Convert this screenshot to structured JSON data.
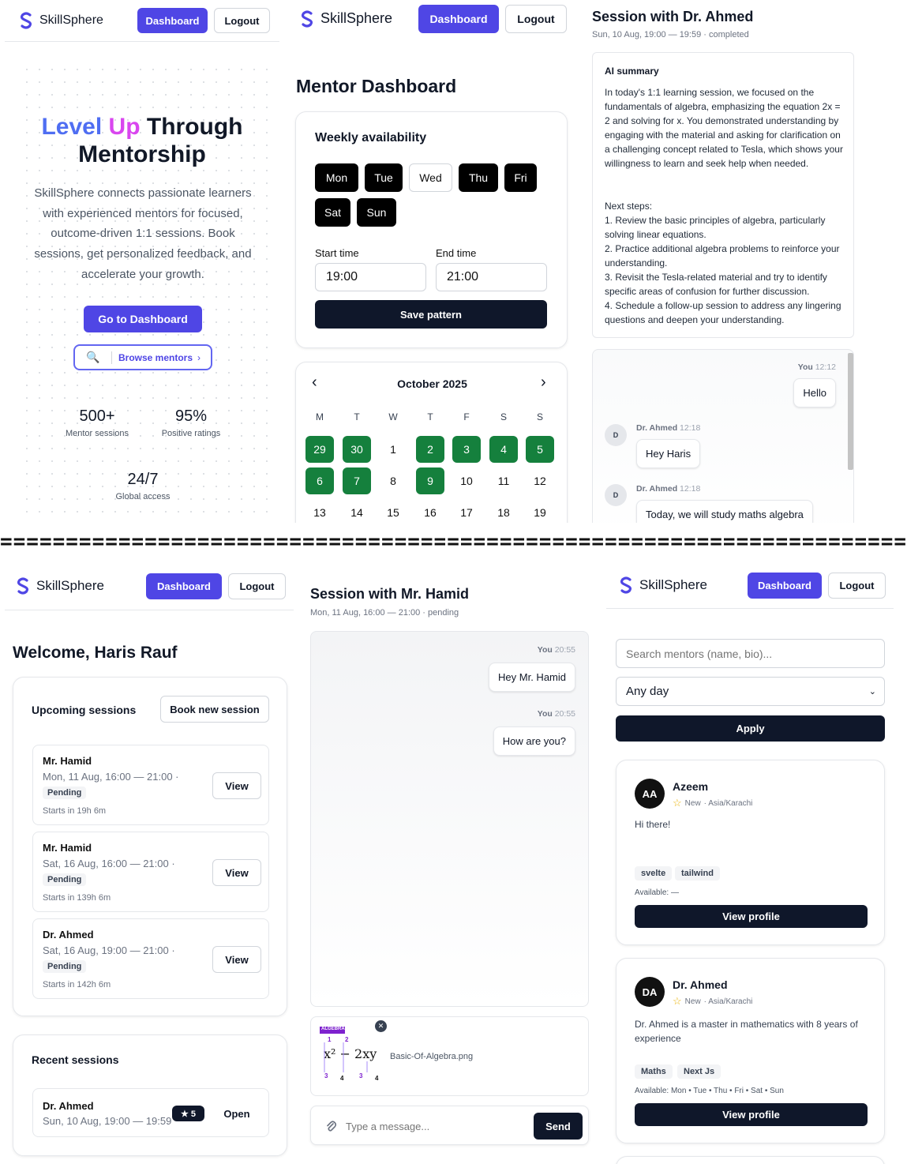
{
  "brand": {
    "name": "SkillSphere",
    "accent": "#4f46e5",
    "dark": "#0f172a",
    "green": "#15803d"
  },
  "nav": {
    "dashboard": "Dashboard",
    "logout": "Logout"
  },
  "divider": "========================================================================================================",
  "landing": {
    "title_w1": "Level",
    "title_w2": "Up",
    "title_rest": "Through",
    "title_line2": "Mentorship",
    "text": "SkillSphere connects passionate learners with experienced mentors for focused, outcome-driven 1:1 sessions. Book sessions, get personalized feedback, and accelerate your growth.",
    "cta": "Go to Dashboard",
    "browse": "Browse mentors",
    "browse_icon": "search-icon",
    "stats": [
      {
        "num": "500+",
        "label": "Mentor sessions"
      },
      {
        "num": "95%",
        "label": "Positive ratings"
      },
      {
        "num": "24/7",
        "label": "Global access"
      }
    ]
  },
  "mentor_dashboard": {
    "title": "Mentor Dashboard",
    "availability_title": "Weekly availability",
    "days": [
      {
        "label": "Mon",
        "on": true
      },
      {
        "label": "Tue",
        "on": true
      },
      {
        "label": "Wed",
        "on": false
      },
      {
        "label": "Thu",
        "on": true
      },
      {
        "label": "Fri",
        "on": true
      },
      {
        "label": "Sat",
        "on": true
      },
      {
        "label": "Sun",
        "on": true
      }
    ],
    "start_label": "Start time",
    "end_label": "End time",
    "start_value": "19:00",
    "end_value": "21:00",
    "save": "Save pattern",
    "calendar": {
      "month": "October 2025",
      "weekdays": [
        "M",
        "T",
        "W",
        "T",
        "F",
        "S",
        "S"
      ],
      "rows": [
        [
          {
            "d": "29",
            "a": true
          },
          {
            "d": "30",
            "a": true
          },
          {
            "d": "1",
            "a": false
          },
          {
            "d": "2",
            "a": true
          },
          {
            "d": "3",
            "a": true
          },
          {
            "d": "4",
            "a": true
          },
          {
            "d": "5",
            "a": true
          }
        ],
        [
          {
            "d": "6",
            "a": true
          },
          {
            "d": "7",
            "a": true
          },
          {
            "d": "8",
            "a": false
          },
          {
            "d": "9",
            "a": true
          },
          {
            "d": "10",
            "a": false
          },
          {
            "d": "11",
            "a": false
          },
          {
            "d": "12",
            "a": false
          }
        ],
        [
          {
            "d": "13",
            "a": false
          },
          {
            "d": "14",
            "a": false
          },
          {
            "d": "15",
            "a": false
          },
          {
            "d": "16",
            "a": false
          },
          {
            "d": "17",
            "a": false
          },
          {
            "d": "18",
            "a": false
          },
          {
            "d": "19",
            "a": false
          }
        ]
      ]
    }
  },
  "session_ahmed": {
    "title": "Session with Dr. Ahmed",
    "subtitle": "Sun, 10 Aug, 19:00 — 19:59 · completed",
    "ai_title": "AI summary",
    "ai_para": "In today's 1:1 learning session, we focused on the fundamentals of algebra, emphasizing the equation 2x = 2 and solving for x. You demonstrated understanding by engaging with the material and asking for clarification on a challenging concept related to Tesla, which shows your willingness to learn and seek help when needed.",
    "next_title": "Next steps:",
    "steps": [
      "1. Review the basic principles of algebra, particularly solving linear equations.",
      "2. Practice additional algebra problems to reinforce your understanding.",
      "3. Revisit the Tesla-related material and try to identify specific areas of confusion for further discussion.",
      "4. Schedule a follow-up session to address any lingering questions and deepen your understanding."
    ],
    "messages": [
      {
        "who": "You",
        "time": "12:12",
        "text": "Hello"
      },
      {
        "who": "Dr. Ahmed",
        "time": "12:18",
        "text": "Hey Haris",
        "avatar": "D"
      },
      {
        "who": "Dr. Ahmed",
        "time": "12:18",
        "text": "Today, we will study maths algebra",
        "avatar": "D"
      }
    ]
  },
  "student_dashboard": {
    "welcome": "Welcome, Haris Rauf",
    "upcoming_title": "Upcoming sessions",
    "book": "Book new session",
    "sessions": [
      {
        "name": "Mr. Hamid",
        "time": "Mon, 11 Aug, 16:00 — 21:00 ·",
        "status": "Pending",
        "starts": "Starts in 19h 6m",
        "action": "View"
      },
      {
        "name": "Mr. Hamid",
        "time": "Sat, 16 Aug, 16:00 — 21:00 ·",
        "status": "Pending",
        "starts": "Starts in 139h 6m",
        "action": "View"
      },
      {
        "name": "Dr. Ahmed",
        "time": "Sat, 16 Aug, 19:00 — 21:00 ·",
        "status": "Pending",
        "starts": "Starts in 142h 6m",
        "action": "View"
      }
    ],
    "recent_title": "Recent sessions",
    "recent": {
      "name": "Dr. Ahmed",
      "time": "Sun, 10 Aug, 19:00 — 19:59",
      "rating": "★ 5",
      "action": "Open"
    }
  },
  "session_hamid": {
    "title": "Session with Mr. Hamid",
    "subtitle": "Mon, 11 Aug, 16:00 — 21:00 · pending",
    "messages": [
      {
        "who": "You",
        "time": "20:55",
        "text": "Hey Mr. Hamid"
      },
      {
        "who": "You",
        "time": "20:55",
        "text": "How are you?"
      }
    ],
    "attachment": {
      "name": "Basic-Of-Algebra.png",
      "thumb_tag": "ALGEBRA"
    },
    "placeholder": "Type a message...",
    "send": "Send"
  },
  "browse": {
    "search_placeholder": "Search mentors (name, bio)...",
    "day_select": "Any day",
    "apply": "Apply",
    "mentors": [
      {
        "initials": "AA",
        "name": "Azeem",
        "badge": "New",
        "tz": "· Asia/Karachi",
        "bio": "Hi there!",
        "tags": [
          "svelte",
          "tailwind"
        ],
        "available_label": "Available:",
        "available": "—",
        "action": "View profile"
      },
      {
        "initials": "DA",
        "name": "Dr. Ahmed",
        "badge": "New",
        "tz": "· Asia/Karachi",
        "bio": "Dr. Ahmed is a master in mathematics with 8 years of experience",
        "tags": [
          "Maths",
          "Next Js"
        ],
        "available_label": "Available:",
        "available": "Mon • Tue • Thu • Fri • Sat • Sun",
        "action": "View profile"
      }
    ]
  }
}
